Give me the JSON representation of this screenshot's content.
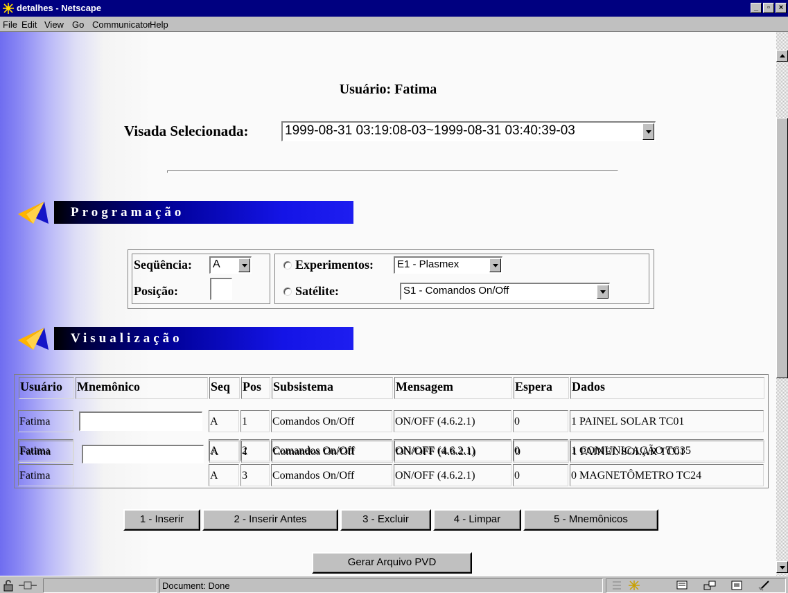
{
  "window": {
    "title": "detalhes - Netscape",
    "minimize_label": "_",
    "maximize_label": "▫",
    "close_label": "×"
  },
  "menu": [
    "File",
    "Edit",
    "View",
    "Go",
    "Communicator",
    "Help"
  ],
  "page": {
    "usuario_title": "Usuário: Fatima",
    "visada_label": "Visada Selecionada:",
    "visada_value": "1999-08-31 03:19:08-03~1999-08-31 03:40:39-03"
  },
  "programacao": {
    "heading": "Programação",
    "sequencia_label": "Seqüência:",
    "sequencia_value": "A",
    "posicao_label": "Posição:",
    "posicao_value": "",
    "experimentos_label": "Experimentos:",
    "experimentos_value": "E1 - Plasmex",
    "satelite_label": "Satélite:",
    "satelite_value": "S1 - Comandos On/Off"
  },
  "visualizacao": {
    "heading": "Visualização",
    "columns": [
      "Usuário",
      "Mnemônico",
      "Seq",
      "Pos",
      "Subsistema",
      "Mensagem",
      "Espera",
      "Dados"
    ],
    "rows": [
      {
        "usuario": "Fatima",
        "mnemonico": "",
        "seq": "A",
        "pos": "1",
        "subsistema": "Comandos On/Off",
        "mensagem": "ON/OFF (4.6.2.1)",
        "espera": "0",
        "dados": "1 PAINEL SOLAR TC01"
      },
      {
        "usuario": "Fatima",
        "mnemonico": "",
        "seq": "A",
        "pos": "2",
        "subsistema": "Comandos On/Off",
        "mensagem": "ON/OFF (4.6.2.1)",
        "espera": "0",
        "dados": "1 COMUNICAÇÃO TC35"
      },
      {
        "usuario": "Fatima",
        "mnemonico": "",
        "seq": "A",
        "pos": "3",
        "subsistema": "Comandos On/Off",
        "mensagem": "ON/OFF (4.6.2.1)",
        "espera": "0",
        "dados": "0 MAGNETÔMETRO TC24"
      }
    ]
  },
  "buttons": {
    "inserir": "1 - Inserir",
    "inserir_antes": "2 - Inserir Antes",
    "excluir": "3 - Excluir",
    "limpar": "4 - Limpar",
    "mnemonicos": "5 - Mnemônicos",
    "gerar": "Gerar Arquivo PVD"
  },
  "status": {
    "text": "Document: Done"
  },
  "colors": {
    "title_bar": "#000080",
    "banner": "#1414e6",
    "chrome": "#c0c0c0"
  }
}
